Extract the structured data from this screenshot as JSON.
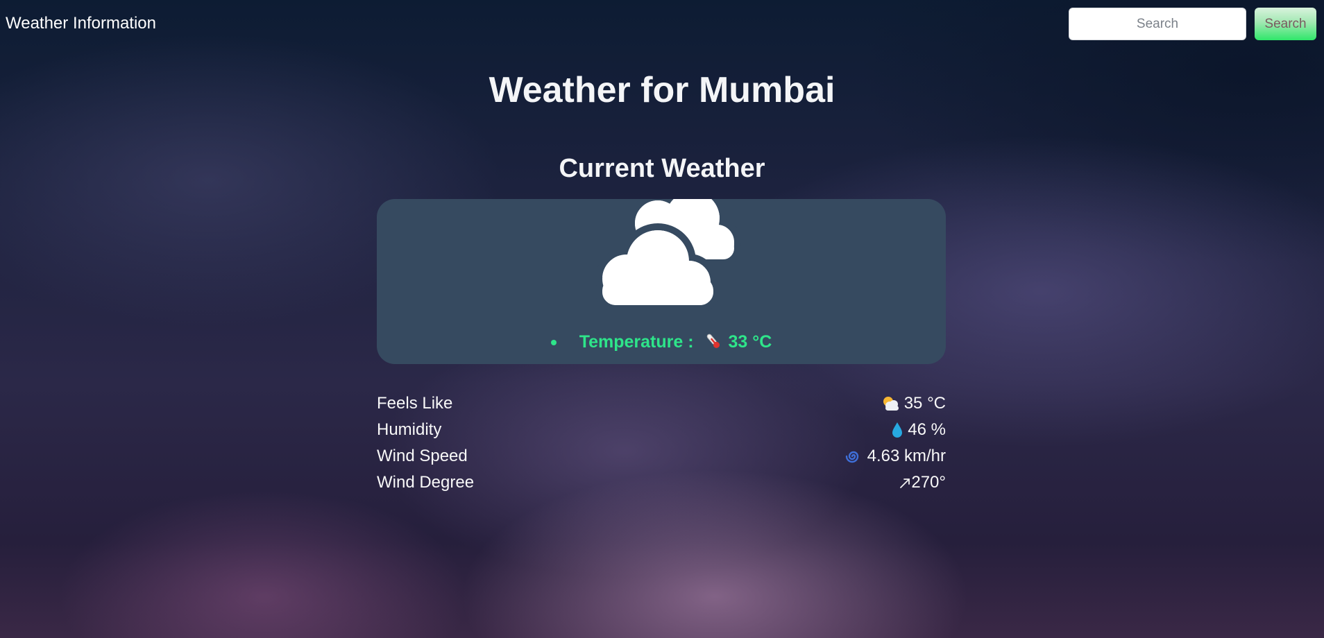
{
  "header": {
    "brand": "Weather Information",
    "search": {
      "placeholder": "Search",
      "button_label": "Search"
    }
  },
  "main": {
    "title": "Weather for Mumbai",
    "section_title": "Current Weather",
    "current": {
      "icon": "cloudy-icon",
      "temperature_label": "Temperature :",
      "temperature_value": "33 °C",
      "temperature_icon": "thermometer-icon",
      "temperature_color": "#2ee58a"
    },
    "details": [
      {
        "label": "Feels Like",
        "value": "35 °C",
        "icon": "sun-behind-cloud-icon"
      },
      {
        "label": "Humidity",
        "value": "46 %",
        "icon": "droplet-icon"
      },
      {
        "label": "Wind Speed",
        "value": "4.63 km/hr",
        "icon": "cyclone-icon"
      },
      {
        "label": "Wind Degree",
        "value": "270°",
        "icon": "arrow-up-right-icon"
      }
    ]
  },
  "colors": {
    "card_background": "#364a60",
    "search_button_gradient_end": "#2fe76a"
  }
}
